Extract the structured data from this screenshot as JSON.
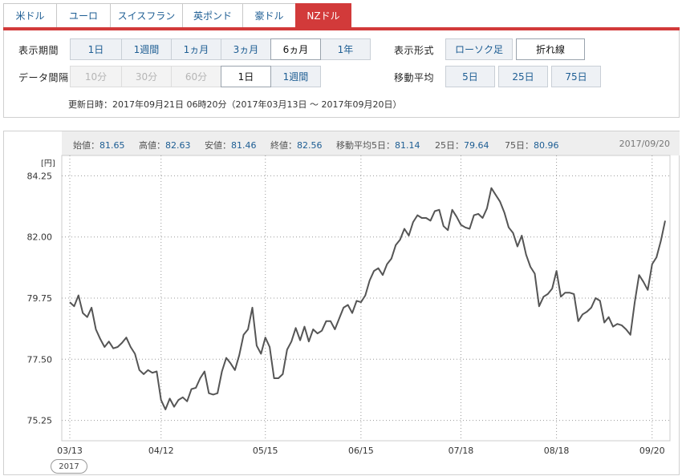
{
  "tabs": [
    {
      "label": "米ドル",
      "active": false
    },
    {
      "label": "ユーロ",
      "active": false
    },
    {
      "label": "スイスフラン",
      "active": false
    },
    {
      "label": "英ポンド",
      "active": false
    },
    {
      "label": "豪ドル",
      "active": false
    },
    {
      "label": "NZドル",
      "active": true
    }
  ],
  "controls": {
    "period_label": "表示期間",
    "period": [
      "1日",
      "1週間",
      "1ヵ月",
      "3ヵ月",
      "6ヵ月",
      "1年"
    ],
    "period_selected": "6ヵ月",
    "interval_label": "データ間隔",
    "interval": [
      "10分",
      "30分",
      "60分",
      "1日",
      "1週間"
    ],
    "interval_disabled": [
      "10分",
      "30分",
      "60分"
    ],
    "interval_selected": "1日",
    "format_label": "表示形式",
    "format": [
      "ローソク足",
      "折れ線"
    ],
    "format_selected": "折れ線",
    "ma_label": "移動平均",
    "ma": [
      "5日",
      "25日",
      "75日"
    ]
  },
  "updated": "更新日時：2017年09月21日 06時20分（2017年03月13日 ～ 2017年09月20日）",
  "stats": {
    "open_label": "始値：",
    "open": "81.65",
    "high_label": "高値：",
    "high": "82.63",
    "low_label": "安値：",
    "low": "81.46",
    "close_label": "終値：",
    "close": "82.56",
    "ma5_label": "移動平均5日：",
    "ma5": "81.14",
    "ma25_label": "25日：",
    "ma25": "79.64",
    "ma75_label": "75日：",
    "ma75": "80.96",
    "date": "2017/09/20"
  },
  "year_badge": "2017",
  "colors": {
    "accent": "#d23a3a",
    "link": "#1d5d93",
    "line": "#555555"
  },
  "chart_data": {
    "type": "line",
    "unit": "[円]",
    "ylim": [
      74.5,
      85.0
    ],
    "yticks": [
      75.25,
      77.5,
      79.75,
      82.0,
      84.25
    ],
    "ytick_labels": [
      "75.25",
      "77.50",
      "79.75",
      "82.00",
      "84.25"
    ],
    "xtick_labels": [
      "03/13",
      "04/12",
      "05/15",
      "06/15",
      "07/18",
      "08/18",
      "09/20"
    ],
    "xtick_index": [
      0,
      21,
      45,
      67,
      90,
      112,
      134
    ],
    "grid": true,
    "series": [
      {
        "values": [
          79.6,
          79.45,
          79.85,
          79.2,
          79.05,
          79.4,
          78.6,
          78.25,
          77.95,
          78.15,
          77.9,
          77.95,
          78.1,
          78.3,
          77.95,
          77.7,
          77.1,
          76.95,
          77.1,
          77.0,
          77.05,
          76.0,
          75.65,
          76.05,
          75.75,
          76.0,
          76.1,
          75.95,
          76.4,
          76.45,
          76.8,
          77.05,
          76.25,
          76.2,
          76.25,
          77.05,
          77.55,
          77.35,
          77.1,
          77.65,
          78.4,
          78.6,
          79.4,
          78.0,
          77.7,
          78.3,
          77.95,
          76.8,
          76.8,
          76.95,
          77.85,
          78.15,
          78.65,
          78.2,
          78.7,
          78.15,
          78.6,
          78.45,
          78.55,
          78.9,
          78.9,
          78.6,
          79.0,
          79.4,
          79.5,
          79.2,
          79.65,
          79.6,
          79.85,
          80.4,
          80.75,
          80.85,
          80.6,
          81.0,
          81.2,
          81.7,
          81.9,
          82.3,
          82.05,
          82.55,
          82.8,
          82.7,
          82.7,
          82.6,
          82.95,
          83.0,
          82.4,
          82.25,
          83.0,
          82.75,
          82.45,
          82.35,
          82.3,
          82.8,
          82.85,
          82.7,
          83.05,
          83.8,
          83.55,
          83.3,
          82.9,
          82.35,
          82.15,
          81.65,
          82.05,
          81.35,
          80.9,
          80.65,
          79.45,
          79.8,
          79.9,
          80.1,
          80.75,
          79.8,
          79.95,
          79.95,
          79.9,
          78.9,
          79.15,
          79.25,
          79.4,
          79.75,
          79.65,
          78.85,
          79.05,
          78.7,
          78.8,
          78.75,
          78.6,
          78.4,
          79.6,
          80.6,
          80.35,
          80.05,
          81.0,
          81.25,
          81.85,
          82.6
        ]
      }
    ]
  }
}
